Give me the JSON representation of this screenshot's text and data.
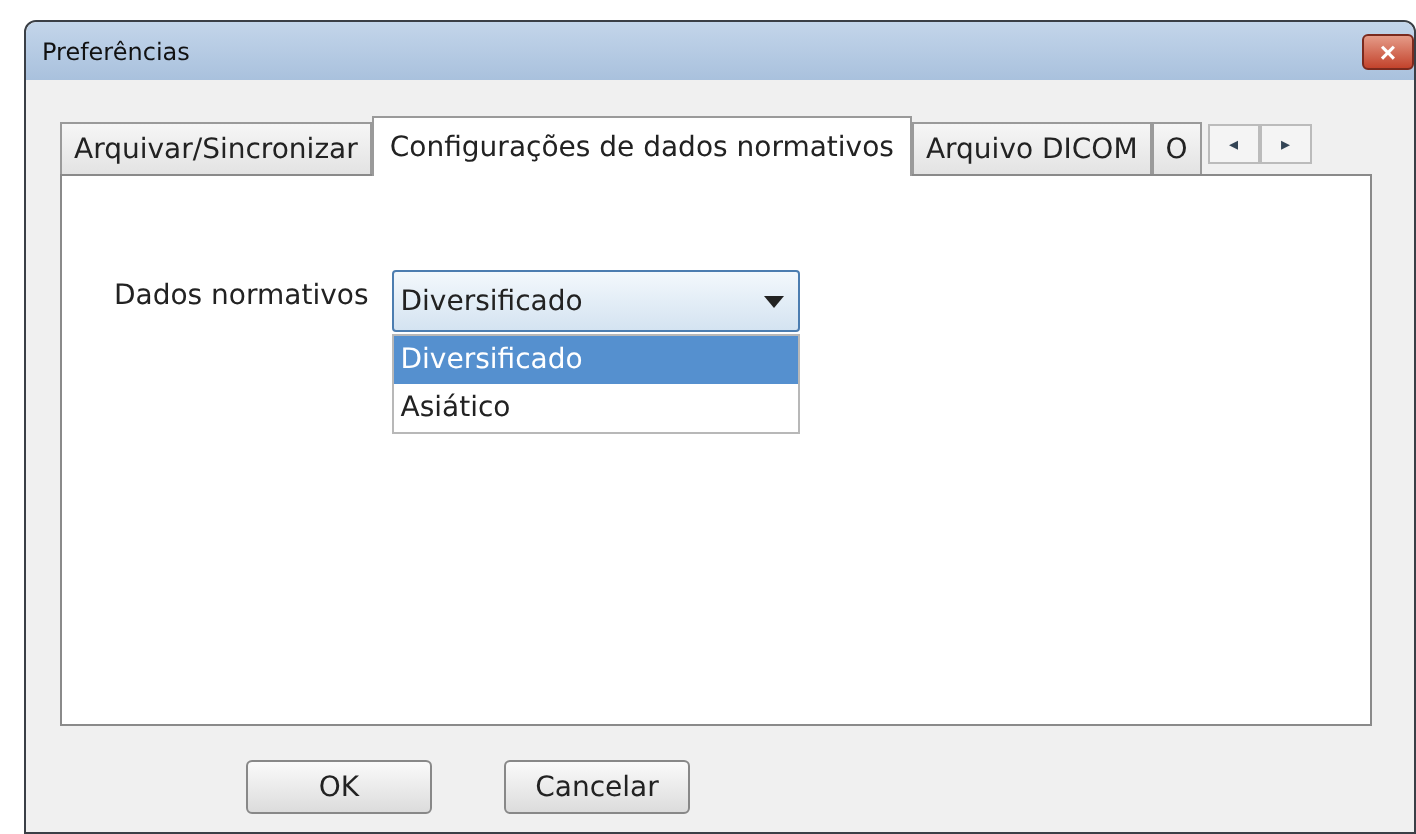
{
  "window": {
    "title": "Preferências",
    "close": "×"
  },
  "tabs": [
    {
      "label": "Arquivar/Sincronizar",
      "selected": false
    },
    {
      "label": "Configurações de dados normativos",
      "selected": true
    },
    {
      "label": "Arquivo DICOM",
      "selected": false
    },
    {
      "label": "O",
      "selected": false
    }
  ],
  "tab_scroll": [
    "◂",
    "▸"
  ],
  "field": {
    "label": "Dados normativos",
    "value": "Diversificado",
    "expanded": true,
    "options": [
      {
        "label": "Diversificado",
        "selected": true
      },
      {
        "label": "Asiático",
        "selected": false
      }
    ]
  },
  "buttons": [
    "OK",
    "Cancelar"
  ]
}
